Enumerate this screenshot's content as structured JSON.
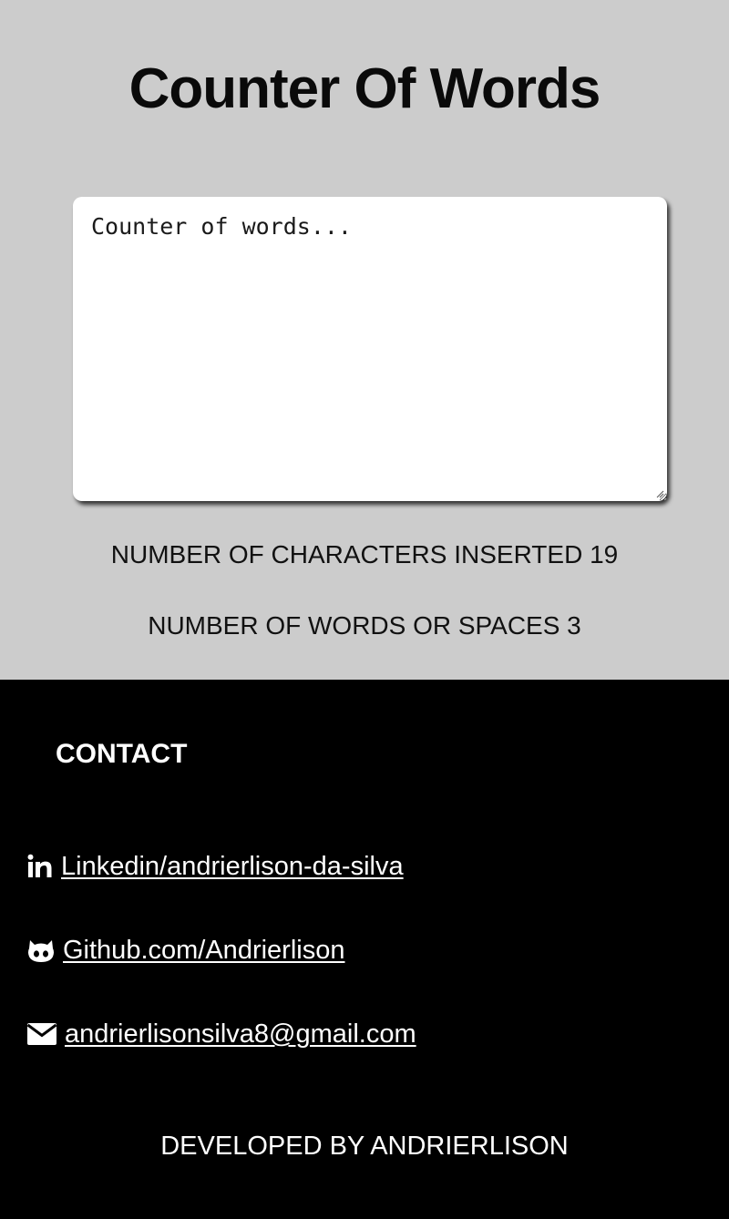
{
  "header": {
    "title": "Counter Of Words"
  },
  "editor": {
    "value": "Counter of words..."
  },
  "stats": {
    "characters_text": "NUMBER OF CHARACTERS INSERTED 19",
    "words_text": "NUMBER OF WORDS OR SPACES 3"
  },
  "footer": {
    "contact_heading": "CONTACT",
    "links": [
      {
        "icon": "linkedin-icon",
        "label": "Linkedin/andrierlison-da-silva"
      },
      {
        "icon": "github-icon",
        "label": "Github.com/Andrierlison"
      },
      {
        "icon": "envelope-icon",
        "label": "andrierlisonsilva8@gmail.com"
      }
    ],
    "credits": "DEVELOPED BY ANDRIERLISON"
  },
  "colors": {
    "main_background": "#cccccc",
    "footer_background": "#000000",
    "textarea_background": "#ffffff",
    "footer_text": "#ffffff"
  }
}
